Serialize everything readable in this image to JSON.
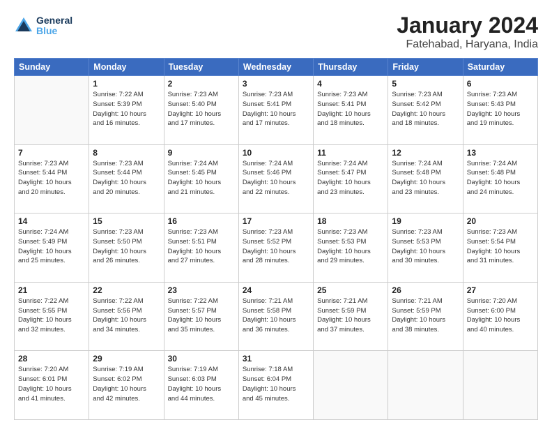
{
  "header": {
    "logo_line1": "General",
    "logo_line2": "Blue",
    "title": "January 2024",
    "subtitle": "Fatehabad, Haryana, India"
  },
  "days_of_week": [
    "Sunday",
    "Monday",
    "Tuesday",
    "Wednesday",
    "Thursday",
    "Friday",
    "Saturday"
  ],
  "weeks": [
    [
      {
        "day": "",
        "info": ""
      },
      {
        "day": "1",
        "info": "Sunrise: 7:22 AM\nSunset: 5:39 PM\nDaylight: 10 hours\nand 16 minutes."
      },
      {
        "day": "2",
        "info": "Sunrise: 7:23 AM\nSunset: 5:40 PM\nDaylight: 10 hours\nand 17 minutes."
      },
      {
        "day": "3",
        "info": "Sunrise: 7:23 AM\nSunset: 5:41 PM\nDaylight: 10 hours\nand 17 minutes."
      },
      {
        "day": "4",
        "info": "Sunrise: 7:23 AM\nSunset: 5:41 PM\nDaylight: 10 hours\nand 18 minutes."
      },
      {
        "day": "5",
        "info": "Sunrise: 7:23 AM\nSunset: 5:42 PM\nDaylight: 10 hours\nand 18 minutes."
      },
      {
        "day": "6",
        "info": "Sunrise: 7:23 AM\nSunset: 5:43 PM\nDaylight: 10 hours\nand 19 minutes."
      }
    ],
    [
      {
        "day": "7",
        "info": "Sunrise: 7:23 AM\nSunset: 5:44 PM\nDaylight: 10 hours\nand 20 minutes."
      },
      {
        "day": "8",
        "info": "Sunrise: 7:23 AM\nSunset: 5:44 PM\nDaylight: 10 hours\nand 20 minutes."
      },
      {
        "day": "9",
        "info": "Sunrise: 7:24 AM\nSunset: 5:45 PM\nDaylight: 10 hours\nand 21 minutes."
      },
      {
        "day": "10",
        "info": "Sunrise: 7:24 AM\nSunset: 5:46 PM\nDaylight: 10 hours\nand 22 minutes."
      },
      {
        "day": "11",
        "info": "Sunrise: 7:24 AM\nSunset: 5:47 PM\nDaylight: 10 hours\nand 23 minutes."
      },
      {
        "day": "12",
        "info": "Sunrise: 7:24 AM\nSunset: 5:48 PM\nDaylight: 10 hours\nand 23 minutes."
      },
      {
        "day": "13",
        "info": "Sunrise: 7:24 AM\nSunset: 5:48 PM\nDaylight: 10 hours\nand 24 minutes."
      }
    ],
    [
      {
        "day": "14",
        "info": "Sunrise: 7:24 AM\nSunset: 5:49 PM\nDaylight: 10 hours\nand 25 minutes."
      },
      {
        "day": "15",
        "info": "Sunrise: 7:23 AM\nSunset: 5:50 PM\nDaylight: 10 hours\nand 26 minutes."
      },
      {
        "day": "16",
        "info": "Sunrise: 7:23 AM\nSunset: 5:51 PM\nDaylight: 10 hours\nand 27 minutes."
      },
      {
        "day": "17",
        "info": "Sunrise: 7:23 AM\nSunset: 5:52 PM\nDaylight: 10 hours\nand 28 minutes."
      },
      {
        "day": "18",
        "info": "Sunrise: 7:23 AM\nSunset: 5:53 PM\nDaylight: 10 hours\nand 29 minutes."
      },
      {
        "day": "19",
        "info": "Sunrise: 7:23 AM\nSunset: 5:53 PM\nDaylight: 10 hours\nand 30 minutes."
      },
      {
        "day": "20",
        "info": "Sunrise: 7:23 AM\nSunset: 5:54 PM\nDaylight: 10 hours\nand 31 minutes."
      }
    ],
    [
      {
        "day": "21",
        "info": "Sunrise: 7:22 AM\nSunset: 5:55 PM\nDaylight: 10 hours\nand 32 minutes."
      },
      {
        "day": "22",
        "info": "Sunrise: 7:22 AM\nSunset: 5:56 PM\nDaylight: 10 hours\nand 34 minutes."
      },
      {
        "day": "23",
        "info": "Sunrise: 7:22 AM\nSunset: 5:57 PM\nDaylight: 10 hours\nand 35 minutes."
      },
      {
        "day": "24",
        "info": "Sunrise: 7:21 AM\nSunset: 5:58 PM\nDaylight: 10 hours\nand 36 minutes."
      },
      {
        "day": "25",
        "info": "Sunrise: 7:21 AM\nSunset: 5:59 PM\nDaylight: 10 hours\nand 37 minutes."
      },
      {
        "day": "26",
        "info": "Sunrise: 7:21 AM\nSunset: 5:59 PM\nDaylight: 10 hours\nand 38 minutes."
      },
      {
        "day": "27",
        "info": "Sunrise: 7:20 AM\nSunset: 6:00 PM\nDaylight: 10 hours\nand 40 minutes."
      }
    ],
    [
      {
        "day": "28",
        "info": "Sunrise: 7:20 AM\nSunset: 6:01 PM\nDaylight: 10 hours\nand 41 minutes."
      },
      {
        "day": "29",
        "info": "Sunrise: 7:19 AM\nSunset: 6:02 PM\nDaylight: 10 hours\nand 42 minutes."
      },
      {
        "day": "30",
        "info": "Sunrise: 7:19 AM\nSunset: 6:03 PM\nDaylight: 10 hours\nand 44 minutes."
      },
      {
        "day": "31",
        "info": "Sunrise: 7:18 AM\nSunset: 6:04 PM\nDaylight: 10 hours\nand 45 minutes."
      },
      {
        "day": "",
        "info": ""
      },
      {
        "day": "",
        "info": ""
      },
      {
        "day": "",
        "info": ""
      }
    ]
  ]
}
